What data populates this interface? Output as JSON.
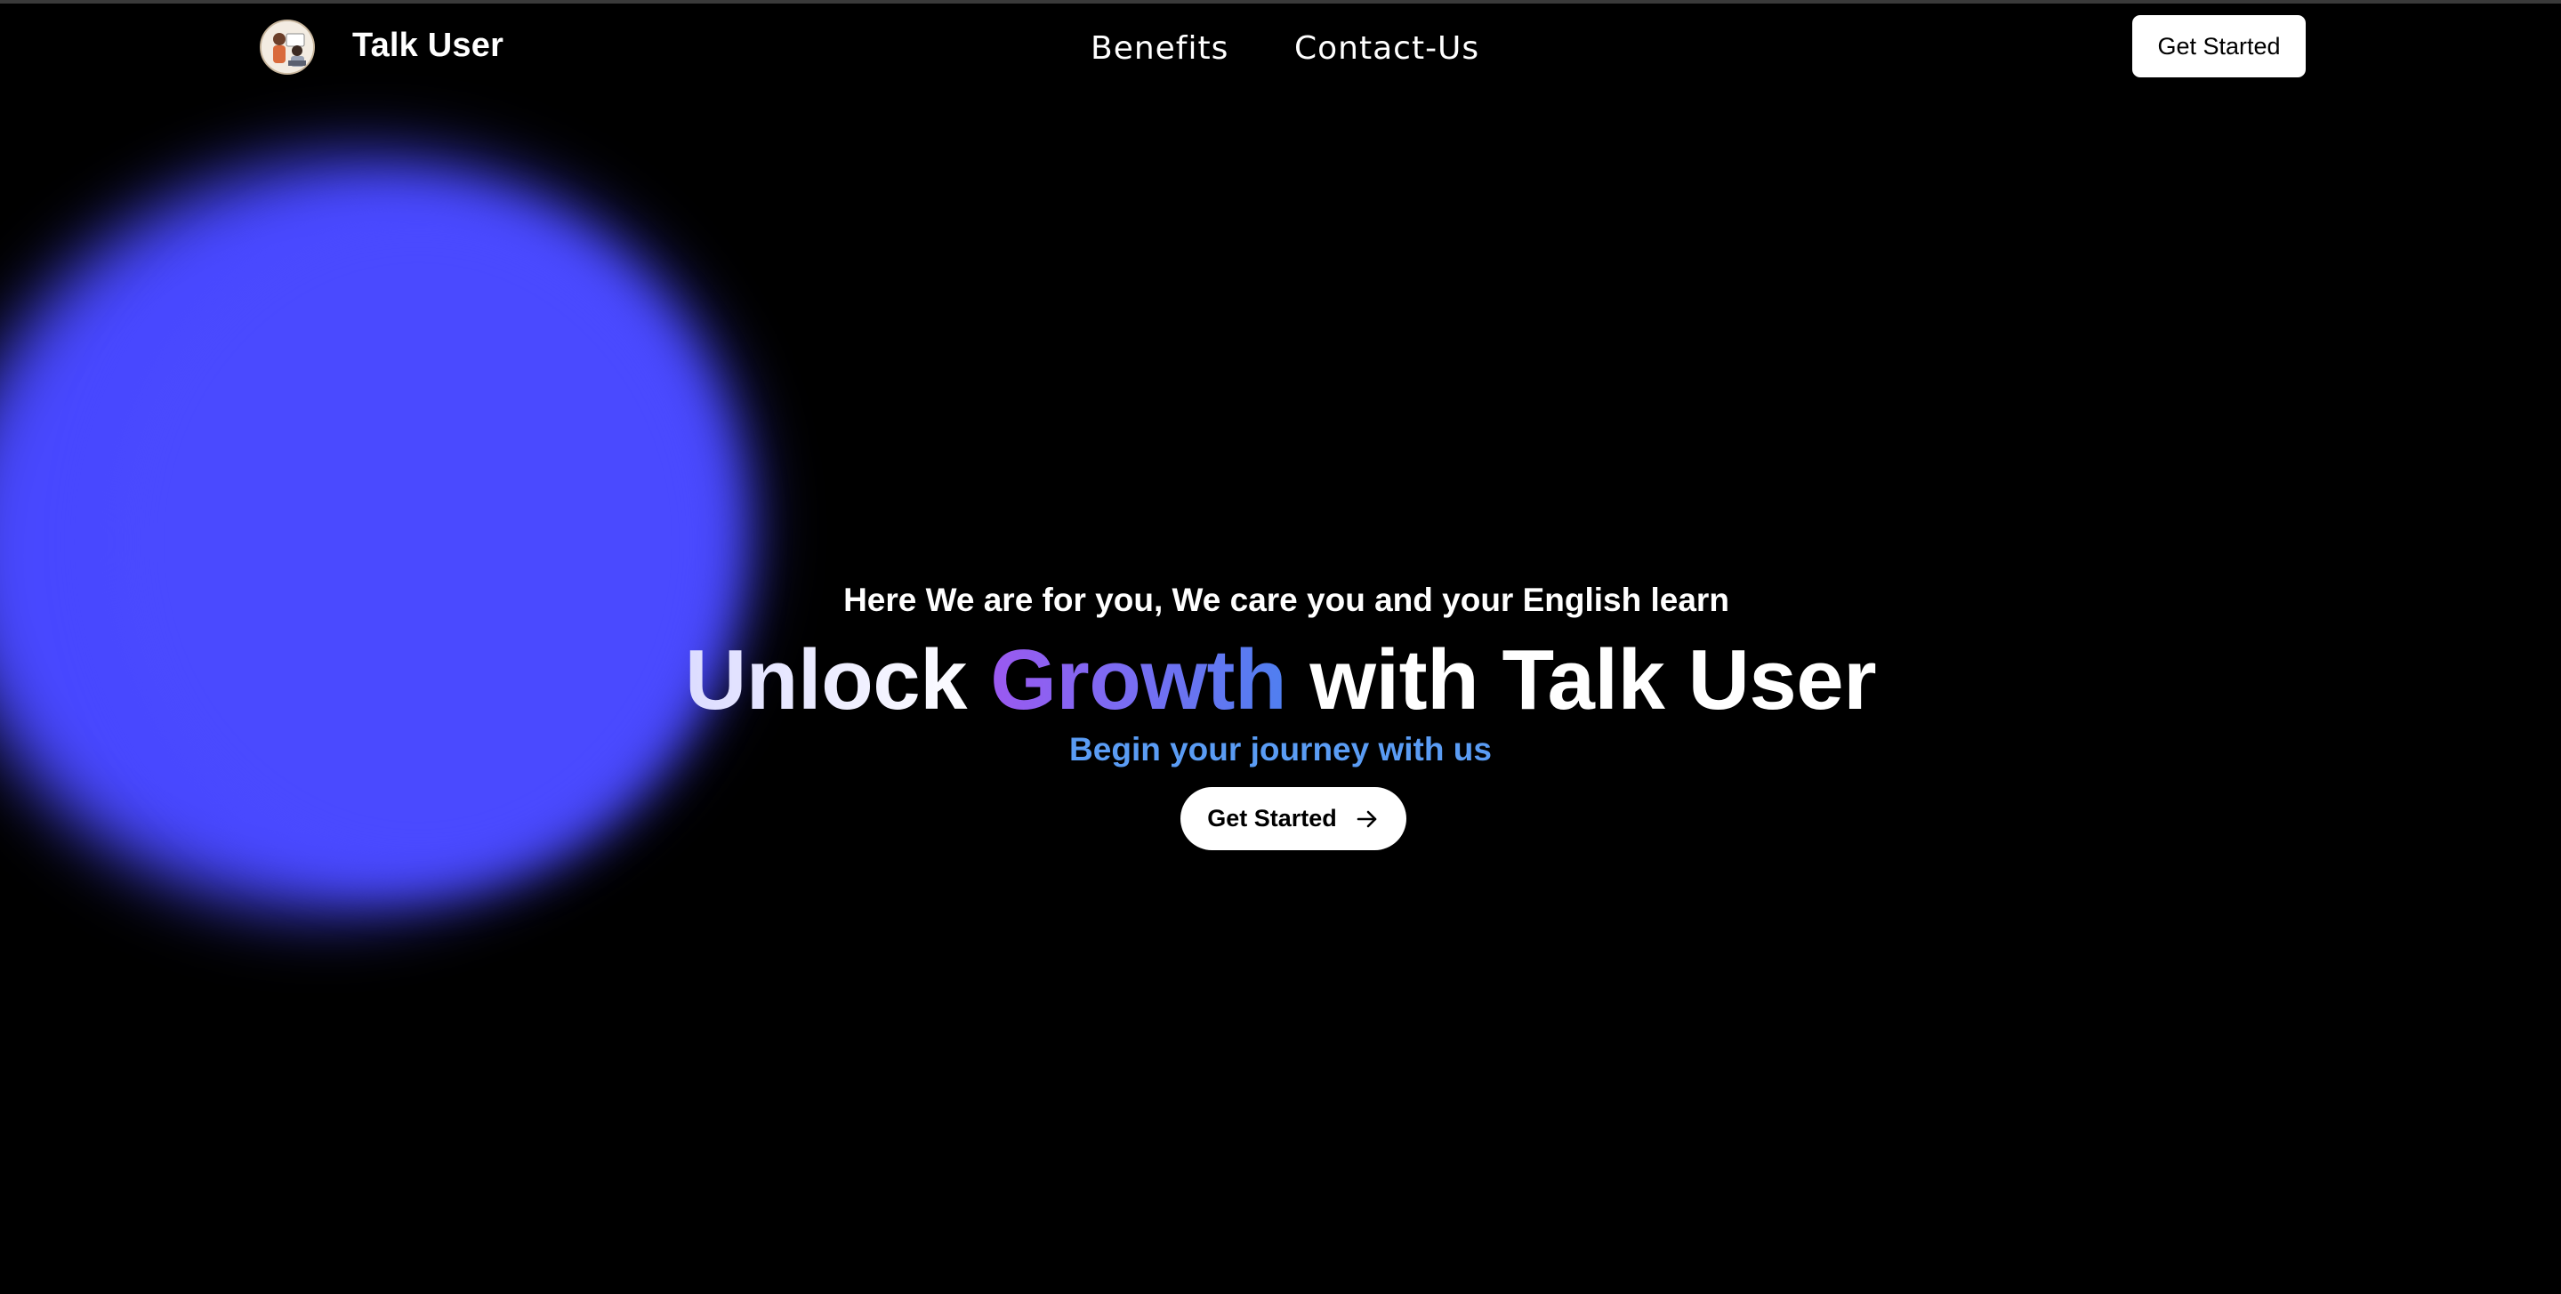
{
  "header": {
    "logo_icon": "talk-user-avatar-icon",
    "brand": "Talk User",
    "nav": [
      {
        "label": "Benefits"
      },
      {
        "label": "Contact-Us"
      }
    ],
    "cta_label": "Get Started"
  },
  "hero": {
    "eyebrow": "Here We are for you, We care you and your English learn",
    "title_part1": "Unlock ",
    "title_highlight": "Growth",
    "title_part2": " with Talk User",
    "subtitle": "Begin your journey with us",
    "cta_label": "Get Started",
    "cta_icon": "arrow-right-icon"
  },
  "colors": {
    "background": "#000000",
    "blob": "#4848ff",
    "subtitle": "#5a9cf4",
    "highlight_start": "#9b59f0",
    "highlight_end": "#4f7ff0"
  }
}
